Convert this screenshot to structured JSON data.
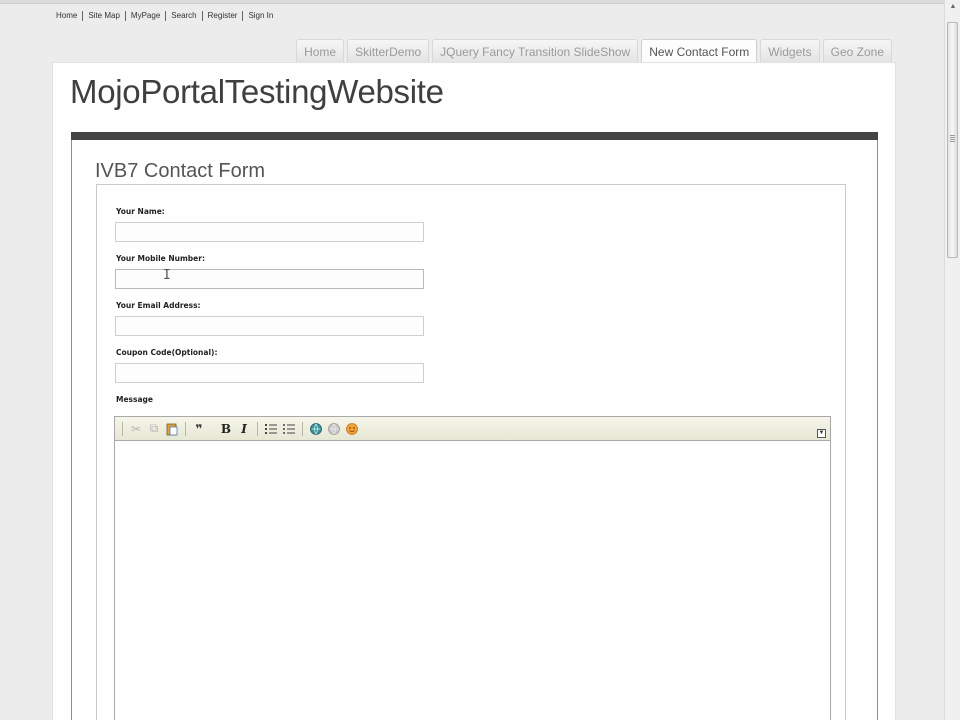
{
  "util_links": [
    "Home",
    "Site Map",
    "MyPage",
    "Search",
    "Register",
    "Sign In"
  ],
  "tabs": [
    {
      "label": "Home",
      "active": false
    },
    {
      "label": "SkitterDemo",
      "active": false
    },
    {
      "label": "JQuery Fancy Transition SlideShow",
      "active": false
    },
    {
      "label": "New Contact Form",
      "active": true
    },
    {
      "label": "Widgets",
      "active": false
    },
    {
      "label": "Geo Zone",
      "active": false
    }
  ],
  "site_title": "MojoPortalTestingWebsite",
  "module_title": "IVB7 Contact Form",
  "form": {
    "name_label": "Your Name:",
    "name_value": "",
    "mobile_label": "Your Mobile Number:",
    "mobile_value": "",
    "email_label": "Your Email Address:",
    "email_value": "",
    "coupon_label": "Coupon Code(Optional):",
    "coupon_value": "",
    "message_label": "Message",
    "message_value": ""
  },
  "editor_toolbar": [
    "cut-icon",
    "copy-icon",
    "paste-icon",
    "blockquote-icon",
    "bold-icon",
    "italic-icon",
    "ordered-list-icon",
    "unordered-list-icon",
    "link-icon",
    "unlink-icon",
    "smiley-icon"
  ],
  "colors": {
    "title_bar": "#444444",
    "page_bg": "#ececec",
    "toolbar_bg": "#efefe0"
  }
}
